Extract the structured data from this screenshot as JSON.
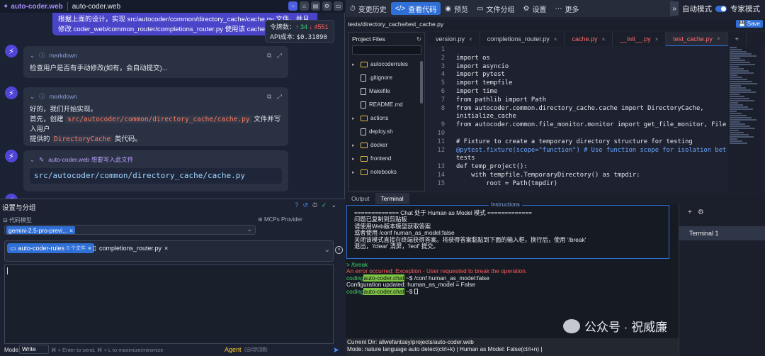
{
  "topbar": {
    "brand": "auto-coder.web",
    "project": "auto-coder.web",
    "icons": [
      "circle-icon",
      "home-icon",
      "file-icon",
      "gear-icon",
      "window-icon"
    ]
  },
  "user_message": "根据上面的设计，实现 src/autocoder/common/directory_cache/cache.py 文件，并且修改 coder_web/common_router/completions_router.py 使用该 cache 类来优化性能",
  "cost": {
    "tokens_label": "令牌数：",
    "tokens_up": "↑ 34",
    "tokens_down": "↓ 4551",
    "api_label": "API成本:",
    "api_value": "$0.31890"
  },
  "messages": [
    {
      "tag": "markdown",
      "text": "检查用户是否有手动修改(如有，会自动提交)..."
    },
    {
      "tag": "markdown",
      "line1": "好的，我们开始实现。",
      "line2a": "首先，创建",
      "code1": "src/autocoder/common/directory_cache/cache.py",
      "line2b": "文件并写入用户",
      "line3a": "提供的",
      "code2": "DirectoryCache",
      "line3b": "类代码。"
    },
    {
      "tag": "auto-coder.web 想要写入此文件",
      "path": "src/autocoder/common/directory_cache/cache.py"
    }
  ],
  "settings": {
    "title": "设置与分组",
    "model_label": "代码模型",
    "mcp_label": "MCPs Provider",
    "model_value": "gemini-2.5-pro-previ...",
    "file_group": "auto-coder-rules",
    "file_group_count": "0 个文件",
    "file2": "completions_router.py"
  },
  "footer": {
    "mode_label": "Mode:",
    "mode_value": "Write",
    "hint": "⌘ + Enter to send, ⌘ + L to maximize/minimize",
    "agent": "Agent",
    "agent_hint": "(自动切换)"
  },
  "right_top": {
    "tabs": [
      "变更历史",
      "查看代码",
      "预览",
      "文件分组",
      "设置",
      "更多"
    ],
    "active": 1,
    "auto_mode": "自动模式",
    "expert_mode": "专家模式"
  },
  "editor_path": "tests/directory_cache/test_cache.py",
  "save": "Save",
  "tree": {
    "title": "Project Files",
    "items": [
      {
        "name": "autocoderrules",
        "type": "dir"
      },
      {
        "name": ".gitignore",
        "type": "file"
      },
      {
        "name": "Makefile",
        "type": "file"
      },
      {
        "name": "README.md",
        "type": "file"
      },
      {
        "name": "actions",
        "type": "dir"
      },
      {
        "name": "deploy.sh",
        "type": "file"
      },
      {
        "name": "docker",
        "type": "dir"
      },
      {
        "name": "frontend",
        "type": "dir"
      },
      {
        "name": "notebooks",
        "type": "dir"
      }
    ]
  },
  "tabs": [
    {
      "name": "version.py",
      "state": "normal"
    },
    {
      "name": "completions_router.py",
      "state": "normal"
    },
    {
      "name": "cache.py",
      "state": "err"
    },
    {
      "name": "__init__.py",
      "state": "err"
    },
    {
      "name": "test_cache.py",
      "state": "active"
    }
  ],
  "code": [
    "",
    "import os",
    "import asyncio",
    "import pytest",
    "import tempfile",
    "import time",
    "from pathlib import Path",
    "from autocoder.common.directory_cache.cache import DirectoryCache,",
    "initialize_cache",
    "from autocoder.common.file_monitor.monitor import get_file_monitor, FileMonitor",
    "",
    "# Fixture to create a temporary directory structure for testing",
    "@pytest.fixture(scope=\"function\") # Use function scope for isolation between",
    "tests",
    "def temp_project():",
    "    with tempfile.TemporaryDirectory() as tmpdir:",
    "        root = Path(tmpdir)"
  ],
  "code_numbers": [
    "1",
    "2",
    "3",
    "4",
    "5",
    "6",
    "7",
    "8",
    "",
    "9",
    "10",
    "11",
    "12",
    "",
    "13",
    "14",
    "15"
  ],
  "panel_tabs": [
    "Output",
    "Terminal"
  ],
  "terminal": {
    "instr_title": "Instructions",
    "instr": "============= Chat 处于 Human as Model 模式 =============\n问题已复制到剪贴板\n请使用Web版本模型获取答案\n或者使用 /conf human_as_model:false\n关闭该模式直接在终端获得答案。将获得答案黏贴到下面的输入框，换行后，使用 '/break'\n退出，'/clear' 清屏，'/eof' 提交。",
    "l1": "> /break",
    "l2": "An error occurred: Exception - User requested to break the operation.",
    "prompt_host": "coding",
    "prompt_name": "auto-coder.chat",
    "prompt_sym": " ~$ ",
    "l3cmd": "/conf human_as_model:false",
    "l4": "Configuration updated: human_as_model = False",
    "status1": "Current Dir: allwefantasy/projects/auto-coder.web",
    "status2": "Mode: nature language auto detect(ctrl+k) | Human as Model: False(ctrl+n) |"
  },
  "term_side": {
    "item": "Terminal 1"
  },
  "watermark": "公众号 · 祝威廉"
}
